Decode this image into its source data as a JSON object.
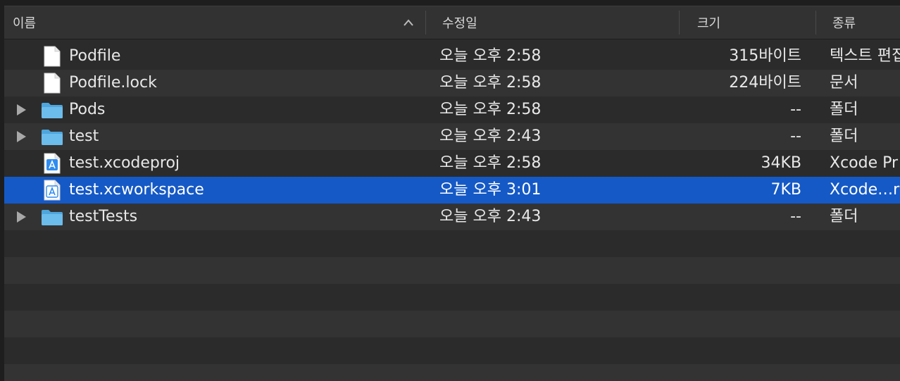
{
  "columns": {
    "name": "이름",
    "date_modified": "수정일",
    "size": "크기",
    "kind": "종류"
  },
  "sort": {
    "column": "name",
    "direction": "ascending",
    "icon": "chevron-up-icon"
  },
  "files": [
    {
      "name": "Podfile",
      "date": "오늘 오후 2:58",
      "size": "315바이트",
      "kind": "텍스트 편집",
      "icon": "document-icon",
      "expandable": false,
      "selected": false
    },
    {
      "name": "Podfile.lock",
      "date": "오늘 오후 2:58",
      "size": "224바이트",
      "kind": "문서",
      "icon": "document-icon",
      "expandable": false,
      "selected": false
    },
    {
      "name": "Pods",
      "date": "오늘 오후 2:58",
      "size": "--",
      "kind": "폴더",
      "icon": "folder-icon",
      "expandable": true,
      "selected": false
    },
    {
      "name": "test",
      "date": "오늘 오후 2:43",
      "size": "--",
      "kind": "폴더",
      "icon": "folder-icon",
      "expandable": true,
      "selected": false
    },
    {
      "name": "test.xcodeproj",
      "date": "오늘 오후 2:58",
      "size": "34KB",
      "kind": "Xcode Pr",
      "icon": "xcode-project-icon",
      "expandable": false,
      "selected": false
    },
    {
      "name": "test.xcworkspace",
      "date": "오늘 오후 3:01",
      "size": "7KB",
      "kind": "Xcode…r",
      "icon": "xcode-workspace-icon",
      "expandable": false,
      "selected": true
    },
    {
      "name": "testTests",
      "date": "오늘 오후 2:43",
      "size": "--",
      "kind": "폴더",
      "icon": "folder-icon",
      "expandable": true,
      "selected": false
    }
  ],
  "colors": {
    "selection": "#1559c6",
    "folder": "#5fb4e6",
    "background": "#2b2b2b",
    "alt_row": "#333333"
  }
}
